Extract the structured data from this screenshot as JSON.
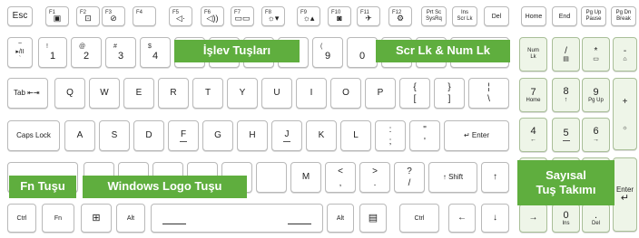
{
  "labels": {
    "function_keys": "İşlev Tuşları",
    "scr_num_lk": "Scr Lk & Num Lk",
    "fn_key": "Fn Tuşu",
    "windows_logo_key": "Windows Logo Tuşu",
    "numeric_keypad_line1": "Sayısal",
    "numeric_keypad_line2": "Tuş Takımı"
  },
  "colors": {
    "label_bg": "#5fae3e",
    "label_text": "#ffffff",
    "keypad_bg": "#eef5e8"
  },
  "row1": {
    "esc": "Esc",
    "f1": "F1",
    "f2": "F2",
    "f3": "F3",
    "f4": "F4",
    "f5": "F5",
    "f6": "F6",
    "f7": "F7",
    "f8": "F8",
    "f9": "F9",
    "f10": "F10",
    "f11": "F11",
    "f12": "F12",
    "prtsc": "Prt Sc",
    "sysrq": "SysRq",
    "ins": "Ins",
    "scrlk": "Scr Lk",
    "del": "Del",
    "home": "Home",
    "end": "End",
    "pgup_top": "Pg Up",
    "pgup_bottom": "Pause",
    "pgdn_top": "Pg Dn",
    "pgdn_bottom": "Break",
    "icons": [
      "mic-mute-icon",
      "webcam-icon",
      "touchpad-off-icon",
      "volume-down-icon",
      "volume-up-icon",
      "display-switch-icon",
      "brightness-down-icon",
      "brightness-up-icon",
      "camera-icon",
      "airplane-mode-icon",
      "settings-icon"
    ]
  },
  "row2": {
    "tilde_top": "~",
    "tilde_mid": "`",
    "tilde_media": "▸/II",
    "k1_top": "!",
    "k1": "1",
    "k2_top": "@",
    "k2": "2",
    "k3_top": "#",
    "k3": "3",
    "k4_top": "$",
    "k4": "4",
    "k9_top": "(",
    "k9": "9",
    "k0": "0",
    "numlk": "Num Lk",
    "np_div": "/",
    "np_mul": "*",
    "np_minus": "-"
  },
  "row3": {
    "tab": "Tab",
    "tab_arrows": "⇤⇥",
    "q": "Q",
    "w": "W",
    "e": "E",
    "r": "R",
    "t": "T",
    "y": "Y",
    "u": "U",
    "i": "I",
    "o": "O",
    "p": "P",
    "lbrace": "{",
    "lbracket": "[",
    "rbrace": "}",
    "rbracket": "]",
    "pipe": "¦",
    "backslash": "\\",
    "np7": "7",
    "np7_sub": "Home",
    "np8": "8",
    "np8_sub": "↑",
    "np9": "9",
    "np9_sub": "Pg Up",
    "np_plus": "+"
  },
  "row4": {
    "caps": "Caps Lock",
    "a": "A",
    "s": "S",
    "d": "D",
    "f": "F",
    "g": "G",
    "h": "H",
    "j": "J",
    "k": "K",
    "l": "L",
    "colon": ":",
    "semicolon": ";",
    "quote_top": "\"",
    "quote": "'",
    "enter": "↵ Enter",
    "np4": "4",
    "np4_sub": "←",
    "np5": "5",
    "np6": "6",
    "np6_sub": "→"
  },
  "row5": {
    "m": "M",
    "lt": "<",
    "comma": ",",
    "gt": ">",
    "period": ".",
    "question": "?",
    "slash": "/",
    "rshift": "↑ Shift",
    "up": "↑",
    "enter_np": "Enter",
    "enter_np_arrow": "↵"
  },
  "row6": {
    "ctrl": "Ctrl",
    "fn": "Fn",
    "alt": "Alt",
    "altgr": "Alt",
    "ctrl_r": "Ctrl",
    "left": "←",
    "down": "↓",
    "right": "→",
    "np0": "0",
    "np0_sub": "Ins",
    "np_dot": ".",
    "np_dot_sub": "Del"
  }
}
